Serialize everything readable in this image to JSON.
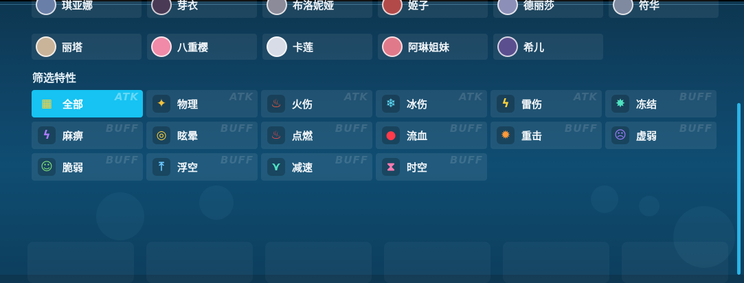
{
  "characters": {
    "row1": [
      {
        "name": "琪亚娜",
        "color": "#6a7fa8"
      },
      {
        "name": "芽衣",
        "color": "#4a3a55"
      },
      {
        "name": "布洛妮娅",
        "color": "#8b8b9a"
      },
      {
        "name": "姬子",
        "color": "#b34a4a"
      },
      {
        "name": "德丽莎",
        "color": "#8c90b8"
      },
      {
        "name": "符华",
        "color": "#7f8aa0"
      }
    ],
    "row2": [
      {
        "name": "丽塔",
        "color": "#c9b49a"
      },
      {
        "name": "八重樱",
        "color": "#f08aa8"
      },
      {
        "name": "卡莲",
        "color": "#d8dce6"
      },
      {
        "name": "阿琳姐妹",
        "color": "#e07a8a"
      },
      {
        "name": "希儿",
        "color": "#5b4f8f"
      }
    ]
  },
  "filter": {
    "title": "筛选特性",
    "tags": {
      "atk": "ATK",
      "buff": "BUFF"
    },
    "items": [
      {
        "label": "全部",
        "tag": "ATK",
        "icon": "grid-icon",
        "glyph": "▦",
        "color": "#ffd23a",
        "active": true
      },
      {
        "label": "物理",
        "tag": "ATK",
        "icon": "sword-icon",
        "glyph": "✦",
        "color": "#f5c23c",
        "active": false
      },
      {
        "label": "火伤",
        "tag": "ATK",
        "icon": "fire-icon",
        "glyph": "♨",
        "color": "#ff5a3c",
        "active": false
      },
      {
        "label": "冰伤",
        "tag": "ATK",
        "icon": "snowflake-icon",
        "glyph": "❄",
        "color": "#5fe3ff",
        "active": false
      },
      {
        "label": "雷伤",
        "tag": "ATK",
        "icon": "lightning-icon",
        "glyph": "ϟ",
        "color": "#ffd23a",
        "active": false
      },
      {
        "label": "冻结",
        "tag": "BUFF",
        "icon": "freeze-burst-icon",
        "glyph": "✸",
        "color": "#4fe3c2",
        "active": false
      },
      {
        "label": "麻痹",
        "tag": "BUFF",
        "icon": "paralysis-bolt-icon",
        "glyph": "ϟ",
        "color": "#b07cff",
        "active": false
      },
      {
        "label": "眩晕",
        "tag": "BUFF",
        "icon": "spiral-icon",
        "glyph": "◎",
        "color": "#ffd23a",
        "active": false
      },
      {
        "label": "点燃",
        "tag": "BUFF",
        "icon": "ignite-icon",
        "glyph": "♨",
        "color": "#ff4a4a",
        "active": false
      },
      {
        "label": "流血",
        "tag": "BUFF",
        "icon": "blood-drop-icon",
        "glyph": "●",
        "color": "#ff3a4a",
        "active": false
      },
      {
        "label": "重击",
        "tag": "BUFF",
        "icon": "impact-burst-icon",
        "glyph": "✹",
        "color": "#ff9a3a",
        "active": false
      },
      {
        "label": "虚弱",
        "tag": "BUFF",
        "icon": "weak-face-icon",
        "glyph": "☹",
        "color": "#a07cff",
        "active": false
      },
      {
        "label": "脆弱",
        "tag": "BUFF",
        "icon": "fragile-mask-icon",
        "glyph": "☺",
        "color": "#7ee07a",
        "active": false
      },
      {
        "label": "浮空",
        "tag": "BUFF",
        "icon": "float-arrow-icon",
        "glyph": "⤒",
        "color": "#6ac8ff",
        "active": false
      },
      {
        "label": "减速",
        "tag": "BUFF",
        "icon": "slow-chevron-icon",
        "glyph": "⋎",
        "color": "#4fe3c2",
        "active": false
      },
      {
        "label": "时空",
        "tag": "BUFF",
        "icon": "hourglass-icon",
        "glyph": "⧗",
        "color": "#ff7ab0",
        "active": false
      }
    ]
  }
}
